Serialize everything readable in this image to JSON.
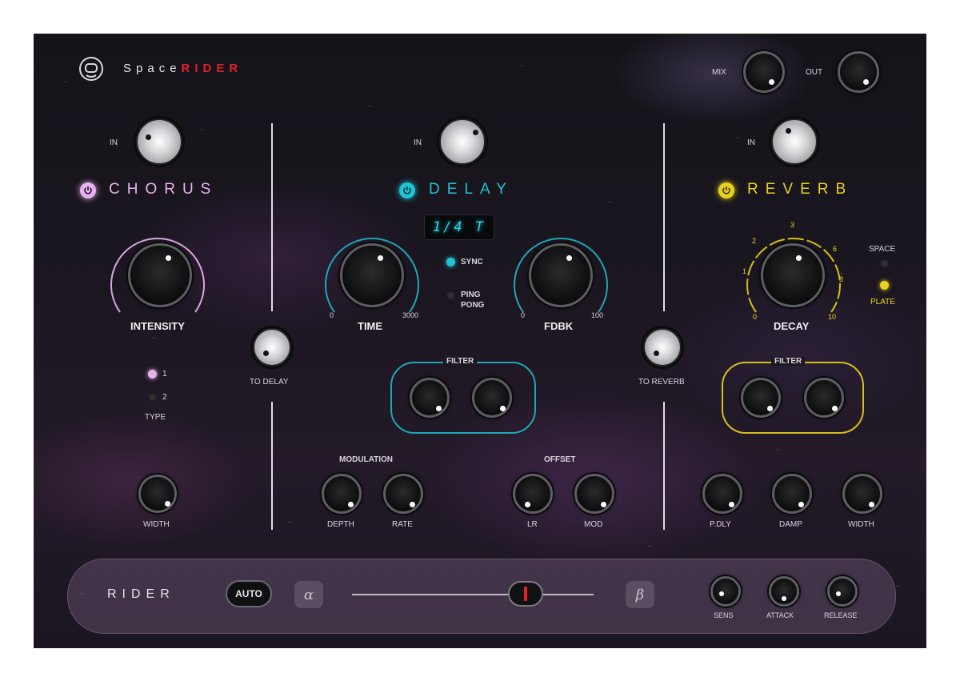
{
  "brand": {
    "prefix": "Space",
    "name": "RIDER",
    "accent": "#e0202a"
  },
  "master": {
    "mix_label": "MIX",
    "out_label": "OUT"
  },
  "chorus": {
    "title": "CHORUS",
    "color": "#e7b3ee",
    "in_label": "IN",
    "intensity_label": "INTENSITY",
    "type_label": "TYPE",
    "type_options": [
      "1",
      "2"
    ],
    "type_selected": "1",
    "width_label": "WIDTH",
    "send_label": "TO DELAY"
  },
  "delay": {
    "title": "DELAY",
    "color": "#1fc3d3",
    "in_label": "IN",
    "display": "1/4 T",
    "time_label": "TIME",
    "time_min": "0",
    "time_max": "3000",
    "sync_label": "SYNC",
    "pingpong_label": [
      "PING",
      "PONG"
    ],
    "fdbk_label": "FDBK",
    "fdbk_min": "0",
    "fdbk_max": "100",
    "filter_label": "FILTER",
    "modulation_label": "MODULATION",
    "depth_label": "DEPTH",
    "rate_label": "RATE",
    "offset_label": "OFFSET",
    "lr_label": "LR",
    "mod_label": "MOD",
    "send_label": "TO REVERB"
  },
  "reverb": {
    "title": "REVERB",
    "color": "#e8d21f",
    "in_label": "IN",
    "decay_label": "DECAY",
    "decay_scale": [
      "0",
      "1",
      "2",
      "3",
      "6",
      "8",
      "10"
    ],
    "space_label": "SPACE",
    "plate_label": "PLATE",
    "filter_label": "FILTER",
    "pdly_label": "P.DLY",
    "damp_label": "DAMP",
    "width_label": "WIDTH"
  },
  "rider": {
    "title": "RIDER",
    "auto_label": "AUTO",
    "alpha": "α",
    "beta": "β",
    "slider_value": 0.72,
    "sens_label": "SENS",
    "attack_label": "ATTACK",
    "release_label": "RELEASE"
  }
}
